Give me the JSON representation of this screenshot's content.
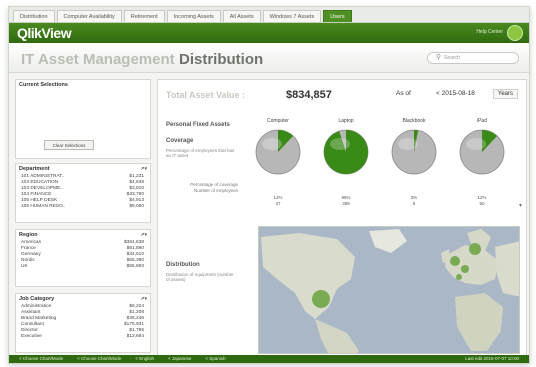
{
  "tabs": [
    "Distribution",
    "Computer Availability",
    "Retirement",
    "Incoming Assets",
    "All Assets",
    "Windows 7 Assets",
    "Users"
  ],
  "active_tab_index": 6,
  "brand": {
    "logo_text": "QlikView",
    "user_label": "Help Center"
  },
  "title": {
    "part1": "IT Asset Management",
    "part2": "Distribution"
  },
  "search": {
    "placeholder": "Search"
  },
  "sidebar": {
    "current_selections": {
      "title": "Current Selections",
      "clear_label": "Clear Selections"
    },
    "department": {
      "title": "Department",
      "items": [
        {
          "label": "101 ADMINISTRAT..",
          "value": "$1,231"
        },
        {
          "label": "103 EDUCATION",
          "value": "$4,638"
        },
        {
          "label": "103 DEVELOPME..",
          "value": "$3,810"
        },
        {
          "label": "104 FINANCE",
          "value": "$33,790"
        },
        {
          "label": "105 HELP DESK",
          "value": "$4,913"
        },
        {
          "label": "106 HUMAN RESO..",
          "value": "$9,050"
        }
      ]
    },
    "region": {
      "title": "Region",
      "items": [
        {
          "label": "Americas",
          "value": "$381,638"
        },
        {
          "label": "France",
          "value": "$61,890"
        },
        {
          "label": "Germany",
          "value": "$34,610"
        },
        {
          "label": "Nordic",
          "value": "$65,380"
        },
        {
          "label": "UK",
          "value": "$55,693"
        }
      ]
    },
    "job_category": {
      "title": "Job Category",
      "items": [
        {
          "label": "Administration",
          "value": "$6,224"
        },
        {
          "label": "Assistant",
          "value": "$1,208"
        },
        {
          "label": "Brand Marketing",
          "value": "$36,246"
        },
        {
          "label": "Consultant",
          "value": "$175,931"
        },
        {
          "label": "Director",
          "value": "$1,796"
        },
        {
          "label": "Executive",
          "value": "$12,684"
        }
      ]
    }
  },
  "kpi": {
    "label": "Total Asset Value :",
    "value": "$834,857",
    "asof_label": "As of",
    "asof_date": "< 2015-08-18",
    "period_button": "Years"
  },
  "personal_fixed_assets": "Personal Fixed Assets",
  "coverage": {
    "title": "Coverage",
    "note": "Percentage of employees that has an IT asset"
  },
  "pies": [
    {
      "label": "Computer",
      "green_fraction": 0.12,
      "pct": "12%",
      "count": "37"
    },
    {
      "label": "Laptop",
      "green_fraction": 0.95,
      "pct": "95%",
      "count": "389"
    },
    {
      "label": "Blackbook",
      "green_fraction": 0.03,
      "pct": "3%",
      "count": "8"
    },
    {
      "label": "iPad",
      "green_fraction": 0.12,
      "pct": "12%",
      "count": "50"
    }
  ],
  "stat_labels": {
    "pct_label": "Percentage of coverage",
    "count_label": "Number of employees"
  },
  "distribution": {
    "title": "Distribution",
    "note": "Distribution of equipment (number of assets)"
  },
  "statusbar": [
    "< Choose Chart/Mode",
    "< Choose Chart/Mode",
    "< English",
    "< Japanese",
    "< Spanish"
  ],
  "statusbar_right": "Last edit 2015-07-07 10:00",
  "colors": {
    "brand_green": "#3f7a18",
    "pie_green": "#3a8a17",
    "pie_grey": "#b7b7b7"
  }
}
